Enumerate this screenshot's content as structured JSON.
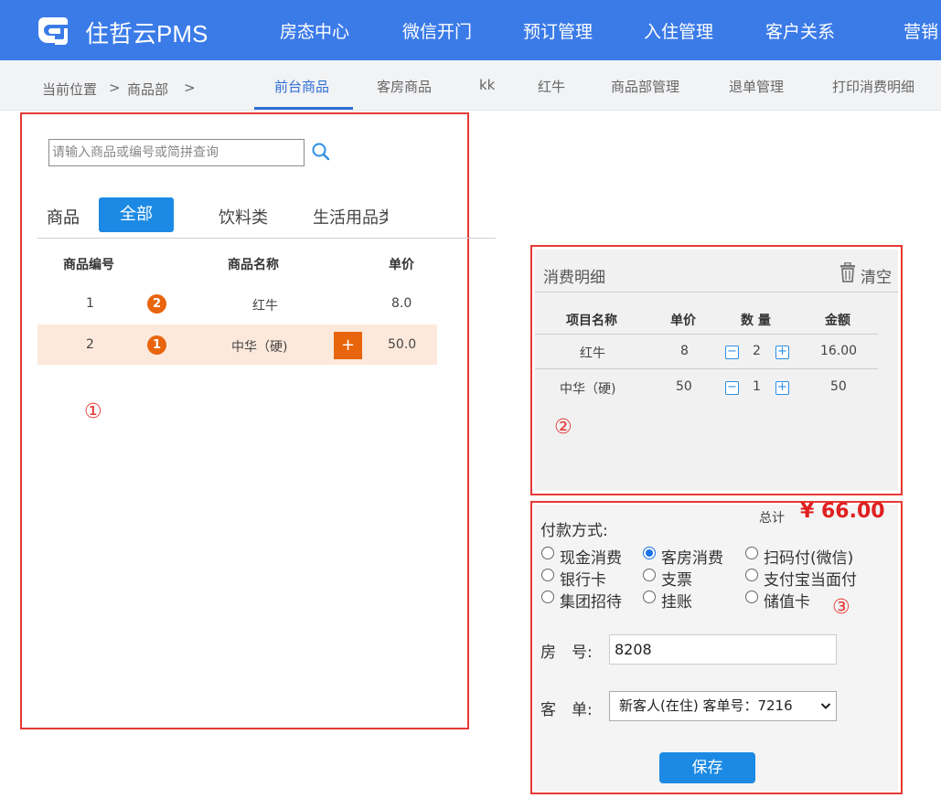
{
  "header": {
    "brand": "住哲云PMS",
    "nav": [
      "房态中心",
      "微信开门",
      "预订管理",
      "入住管理",
      "客户关系",
      "营销"
    ]
  },
  "breadcrumb": {
    "label": "当前位置",
    "sep1": ">",
    "current": "商品部",
    "sep2": ">"
  },
  "subtabs": [
    "前台商品",
    "客房商品",
    "kk",
    "红牛",
    "商品部管理",
    "退单管理",
    "打印消费明细"
  ],
  "products": {
    "search_placeholder": "请输入商品或编号或简拼查询",
    "category_label": "商品",
    "categories": [
      "全部",
      "饮料类",
      "生活用品类"
    ],
    "columns": [
      "商品编号",
      "商品名称",
      "单价"
    ],
    "rows": [
      {
        "id": "1",
        "badge": "2",
        "name": "红牛",
        "price": "8.0"
      },
      {
        "id": "2",
        "badge": "1",
        "name": "中华（硬)",
        "price": "50.0",
        "add": "+"
      }
    ]
  },
  "annotations": [
    "①",
    "②",
    "③"
  ],
  "detail": {
    "title": "消费明细",
    "clear": "清空",
    "columns": [
      "项目名称",
      "单价",
      "数 量",
      "金额"
    ],
    "rows": [
      {
        "name": "红牛",
        "price": "8",
        "qty": "2",
        "amount": "16.00"
      },
      {
        "name": "中华（硬)",
        "price": "50",
        "qty": "1",
        "amount": "50"
      }
    ],
    "minus": "−",
    "plus": "+"
  },
  "payment": {
    "total_label": "总计",
    "total_value": "¥ 66.00",
    "method_label": "付款方式:",
    "methods": [
      "现金消费",
      "客房消费",
      "扫码付(微信)",
      "银行卡",
      "支票",
      "支付宝当面付",
      "集团招待",
      "挂账",
      "储值卡"
    ],
    "selected": "客房消费",
    "room_label": "房　号:",
    "room_value": "8208",
    "guest_label": "客　单:",
    "guest_value": "新客人(在住) 客单号：7216",
    "save": "保存"
  },
  "colors": {
    "header_bg": "#3b7be8",
    "accent_blue": "#1c8ae4",
    "badge_orange": "#e8650d",
    "highlight_row": "#fde9dc",
    "annotation_red": "#e53935",
    "total_red": "#e02020"
  }
}
